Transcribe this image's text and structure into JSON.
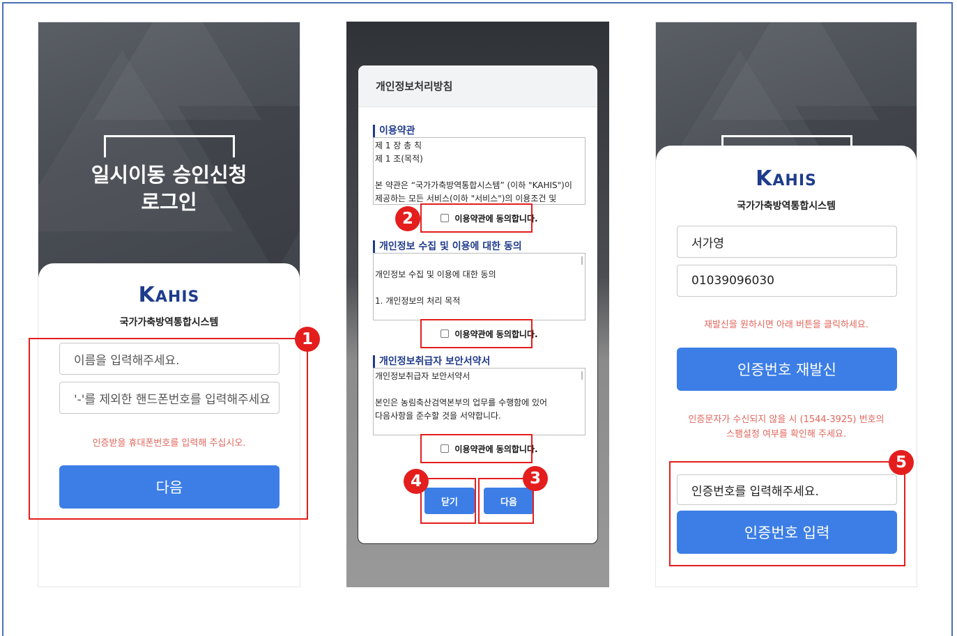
{
  "screen1": {
    "title_line1": "일시이동 승인신청",
    "title_line2": "로그인",
    "logo_k": "K",
    "logo_rest": "AHIS",
    "org_name": "국가가축방역통합시스템",
    "name_placeholder": "이름을 입력해주세요.",
    "phone_placeholder": "'-'를 제외한 핸드폰번호를 입력해주세요",
    "notice": "인증받을 휴대폰번호를 입력해 주십시오.",
    "next_label": "다음",
    "badge": "1"
  },
  "screen2": {
    "modal_title": "개인정보처리방침",
    "sections": [
      {
        "title": "이용약관",
        "lines": [
          "제 1 장 총 칙",
          "제 1 조(목적)",
          "",
          "  본 약관은 “국가가축방역통합시스템” (이하 \"KAHIS\")이",
          "제공하는 모든 서비스(이하 \"서비스\")의 이용조건 및"
        ],
        "agree": "이용약관에 동의합니다."
      },
      {
        "title": "개인정보 수집 및 이용에 대한 동의",
        "lines": [
          "",
          "개인정보 수집 및 이용에 대한 동의",
          "",
          "1. 개인정보의 처리 목적"
        ],
        "agree": "이용약관에 동의합니다."
      },
      {
        "title": "개인정보취급자 보안서약서",
        "lines": [
          "개인정보취급자 보안서약서",
          "",
          "본인은 농림축산검역본부의 업무를 수행함에 있어",
          "다음사항을 준수할 것을 서약합니다."
        ],
        "agree": "이용약관에 동의합니다."
      }
    ],
    "close_label": "닫기",
    "next_label": "다음",
    "badges": [
      "2",
      "3",
      "4"
    ]
  },
  "screen3": {
    "logo_k": "K",
    "logo_rest": "AHIS",
    "org_name": "국가가축방역통합시스템",
    "name_value": "서가영",
    "phone_value": "01039096030",
    "resend_notice": "재발신을 원하시면 아래 버튼을 클릭하세요.",
    "resend_label": "인증번호 재발신",
    "spam_notice_line1": "인증문자가 수신되지 않을 시 (1544-3925) 번호의",
    "spam_notice_line2": "스팸설정 여부를 확인해 주세요.",
    "code_placeholder": "인증번호를 입력해주세요.",
    "submit_label": "인증번호 입력",
    "badge": "5"
  },
  "colors": {
    "accent_blue": "#3c7ee6",
    "highlight_red": "#e41d1d",
    "notice_red": "#e0665c",
    "brand_navy": "#1e3c8c"
  }
}
